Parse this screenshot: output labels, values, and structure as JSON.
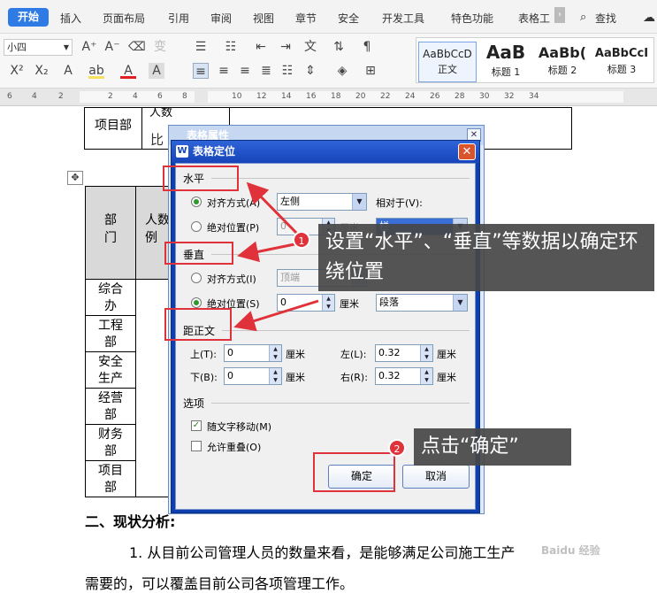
{
  "ribbon": {
    "tabs": [
      "开始",
      "插入",
      "页面布局",
      "引用",
      "审阅",
      "视图",
      "章节",
      "安全",
      "开发工具",
      "特色功能",
      "表格工"
    ],
    "search_label": "查找",
    "font_size": "小四"
  },
  "styles": [
    {
      "sample": "AaBbCcD",
      "name": "正文"
    },
    {
      "sample": "AaB",
      "name": "标题 1"
    },
    {
      "sample": "AaBb(",
      "name": "标题 2"
    },
    {
      "sample": "AaBbCcI",
      "name": "标题 3"
    }
  ],
  "ruler": [
    "6",
    "4",
    "2",
    "2",
    "4",
    "6",
    "8",
    "10",
    "12",
    "14",
    "16",
    "18",
    "20",
    "22",
    "24",
    "26",
    "28",
    "30",
    "32",
    "34"
  ],
  "doc": {
    "top_table": {
      "dept": "项目部",
      "partial": "人数",
      "cell_bi": "比"
    },
    "main_table": {
      "header_dept": "部门",
      "header_staff": "人数\n例",
      "rows": [
        "综合办",
        "工程部",
        "安全生产",
        "经营部",
        "财务部",
        "项目部"
      ]
    },
    "heading": "二、现状分析:",
    "para1": "1. 从目前公司管理人员的数量来看，是能够满足公司施工生产",
    "para2": "需要的，可以覆盖目前公司各项管理工作。"
  },
  "back_dialog": {
    "title": "表格属性"
  },
  "dialog": {
    "title": "表格定位",
    "horizontal": {
      "group": "水平",
      "align_label": "对齐方式(A)",
      "align_value": "左侧",
      "relative_label": "相对于(V):",
      "pos_label": "绝对位置(P)",
      "pos_value": "0",
      "unit": "厘米",
      "relative_value": "栏"
    },
    "vertical": {
      "group": "垂直",
      "align_label": "对齐方式(I)",
      "align_value": "顶端",
      "pos_label": "绝对位置(S)",
      "pos_value": "0",
      "unit": "厘米",
      "relative_value": "段落"
    },
    "distance": {
      "group": "距正文",
      "top_label": "上(T):",
      "top_value": "0",
      "bottom_label": "下(B):",
      "bottom_value": "0",
      "left_label": "左(L):",
      "left_value": "0.32",
      "right_label": "右(R):",
      "right_value": "0.32",
      "unit": "厘米"
    },
    "options": {
      "group": "选项",
      "move_with_text": "随文字移动(M)",
      "allow_overlap": "允许重叠(O)"
    },
    "ok": "确定",
    "cancel": "取消"
  },
  "annotations": {
    "badge1": "1",
    "badge2": "2",
    "callout1": "设置“水平”、“垂直”等数据以确定环绕位置",
    "callout2": "点击“确定”"
  },
  "watermark": "Baidu 经验",
  "colors": {
    "accent": "#2f7be6",
    "annotation_red": "#e0323a",
    "dialog_title": "#1645b8"
  }
}
